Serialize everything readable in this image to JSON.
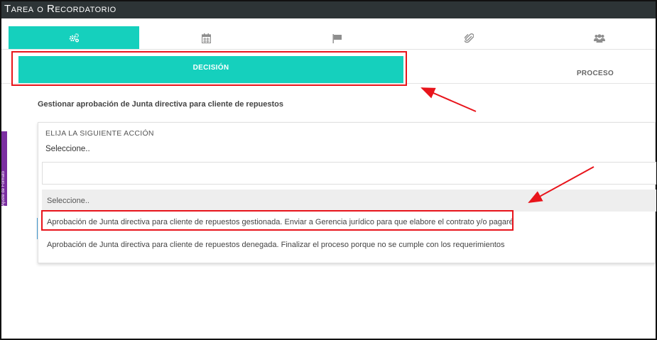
{
  "window": {
    "title": "Tarea o Recordatorio"
  },
  "icon_tabs": [
    {
      "icon": "gears-icon",
      "active": true
    },
    {
      "icon": "calendar-icon",
      "active": false
    },
    {
      "icon": "flag-icon",
      "active": false
    },
    {
      "icon": "paperclip-icon",
      "active": false
    },
    {
      "icon": "users-icon",
      "active": false
    }
  ],
  "sub_tabs": {
    "decision": "DECISIÓN",
    "proceso": "PROCESO"
  },
  "side_tab": {
    "label": "Ajuste de Formato"
  },
  "task": {
    "title": "Gestionar aprobación de Junta directiva para cliente de repuestos"
  },
  "action_select": {
    "label": "ELIJA LA SIGUIENTE ACCIÓN",
    "selected": "Seleccione..",
    "search_value": "",
    "options": [
      "Seleccione..",
      "Aprobación de Junta directiva para cliente de repuestos gestionada. Enviar a Gerencia jurídico para que elabore el contrato y/o pagaré",
      "Aprobación de Junta directiva para cliente de repuestos denegada. Finalizar el proceso porque no se cumple con los requerimientos"
    ]
  },
  "colors": {
    "accent": "#15d0bd",
    "title_bar": "#2d3436",
    "annotation": "#e8141b",
    "side_tab": "#7b2ea1"
  }
}
